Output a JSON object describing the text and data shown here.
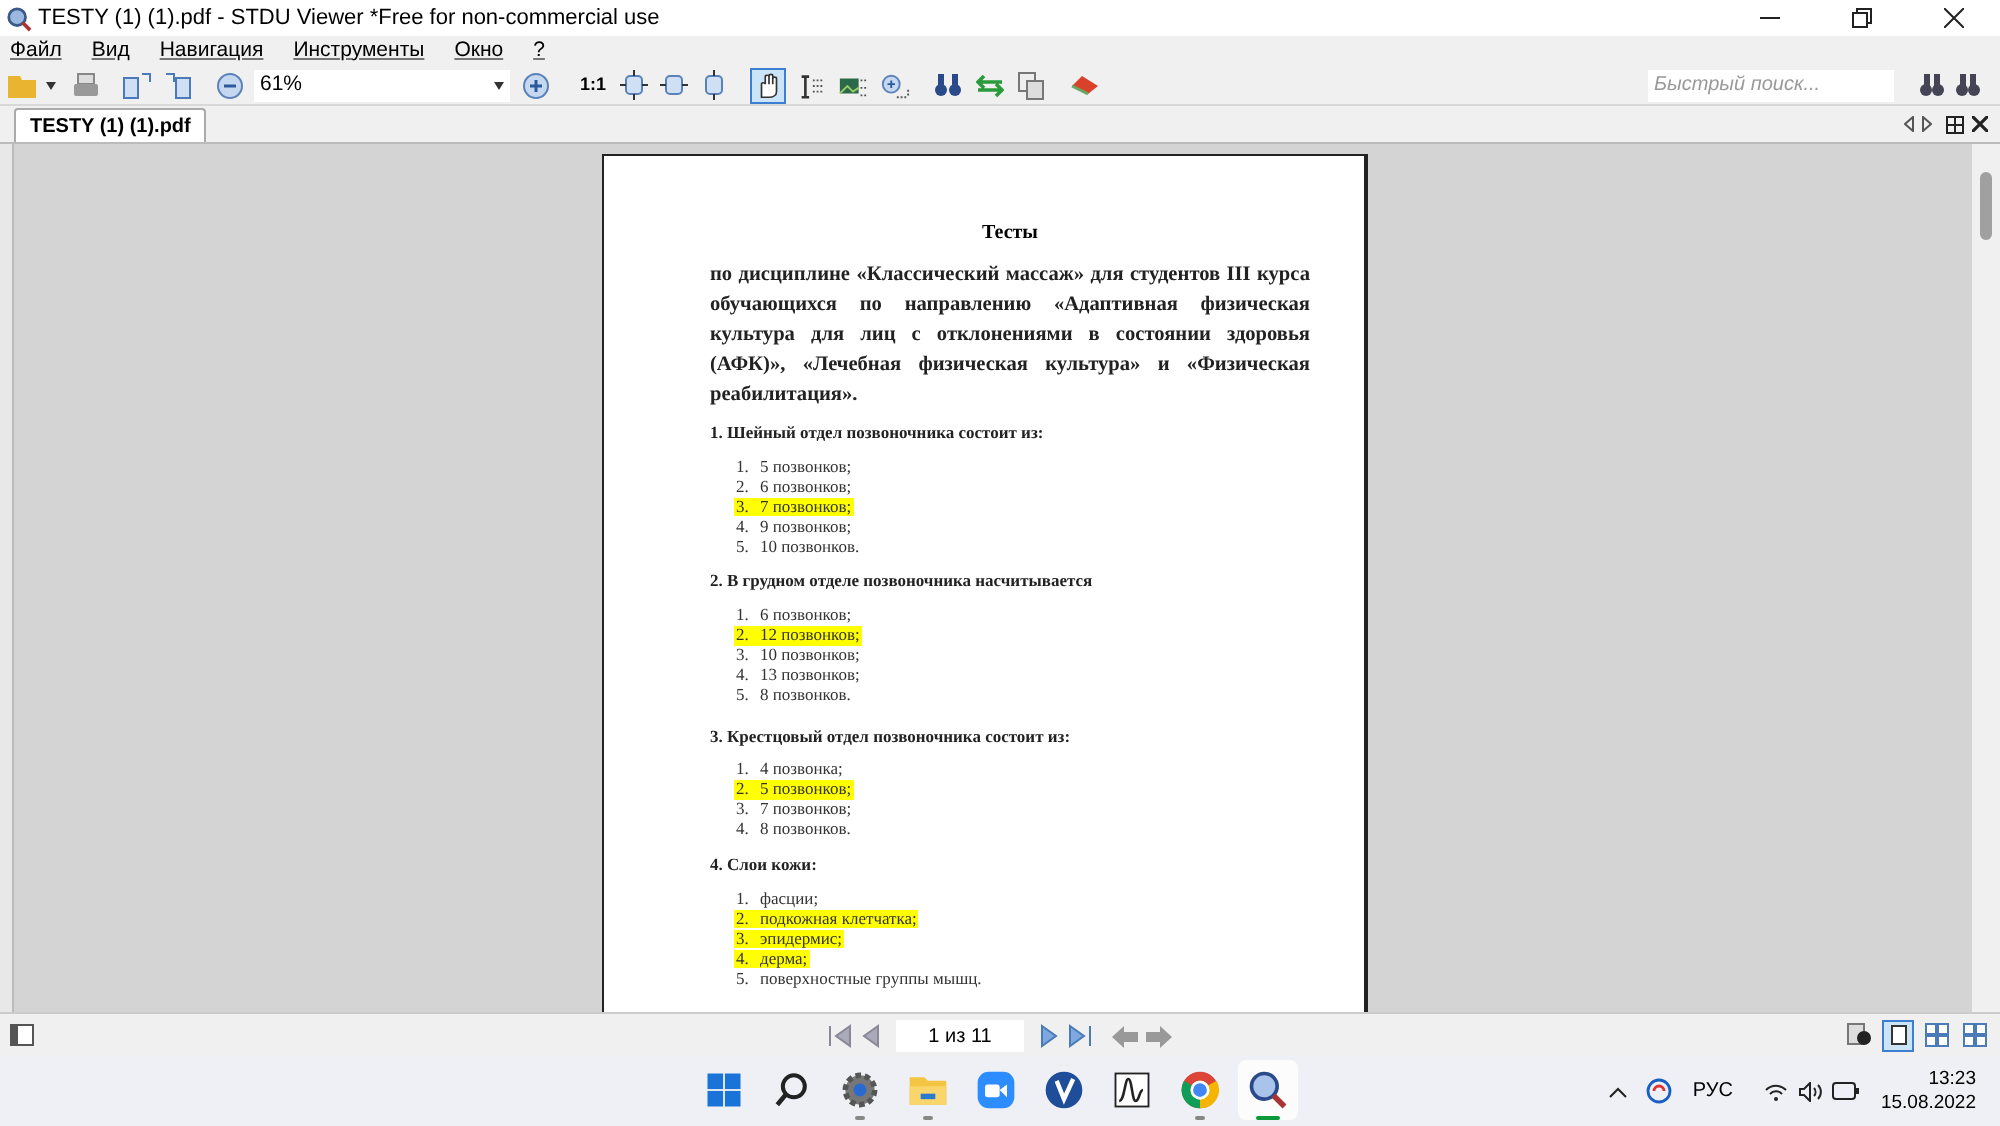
{
  "window": {
    "title": "TESTY (1) (1).pdf - STDU Viewer *Free for non-commercial use"
  },
  "menu": [
    "Файл",
    "Вид",
    "Навигация",
    "Инструменты",
    "Окно",
    "?"
  ],
  "toolbar": {
    "zoom": "61%",
    "one_to_one": "1:1",
    "search_placeholder": "Быстрый поиск...",
    "tools": [
      {
        "kind": "hand",
        "selected": true
      },
      {
        "kind": "text-select",
        "selected": false
      },
      {
        "kind": "image-select",
        "selected": false
      },
      {
        "kind": "zoom-select",
        "selected": false
      }
    ]
  },
  "tabs": [
    {
      "label": "TESTY (1) (1).pdf",
      "selected": true
    }
  ],
  "document": {
    "title": "Тесты",
    "intro": "по дисциплине «Классический массаж» для студентов III курса обучающихся по направлению «Адаптивная физическая культура для лиц с отклонениями в состоянии здоровья (АФК)», «Лечебная физическая культура» и «Физическая реабилитация».",
    "questions": [
      {
        "text": "1. Шейный отдел позвоночника состоит из:",
        "items": [
          {
            "number": "1.",
            "text": "5 позвонков;",
            "highlighted": false
          },
          {
            "number": "2.",
            "text": "6 позвонков;",
            "highlighted": false
          },
          {
            "number": "3.",
            "text": "7 позвонков;",
            "highlighted": true
          },
          {
            "number": "4.",
            "text": "9 позвонков;",
            "highlighted": false
          },
          {
            "number": "5.",
            "text": "10 позвонков.",
            "highlighted": false
          }
        ]
      },
      {
        "text": "2. В грудном отделе позвоночника насчитывается",
        "items": [
          {
            "number": "1.",
            "text": "6 позвонков;",
            "highlighted": false
          },
          {
            "number": "2.",
            "text": "12 позвонков;",
            "highlighted": true
          },
          {
            "number": "3.",
            "text": "10 позвонков;",
            "highlighted": false
          },
          {
            "number": "4.",
            "text": "13 позвонков;",
            "highlighted": false
          },
          {
            "number": "5.",
            "text": "8 позвонков.",
            "highlighted": false
          }
        ]
      },
      {
        "text": "3. Крестцовый отдел позвоночника состоит из:",
        "items": [
          {
            "number": "1.",
            "text": "4 позвонка;",
            "highlighted": false
          },
          {
            "number": "2.",
            "text": "5 позвонков;",
            "highlighted": true
          },
          {
            "number": "3.",
            "text": "7 позвонков;",
            "highlighted": false
          },
          {
            "number": "4.",
            "text": "8 позвонков.",
            "highlighted": false
          }
        ]
      },
      {
        "text": "4. Слои кожи:",
        "items": [
          {
            "number": "1.",
            "text": "фасции;",
            "highlighted": false
          },
          {
            "number": "2.",
            "text": "подкожная клетчатка;",
            "highlighted": true
          },
          {
            "number": "3.",
            "text": "эпидермис;",
            "highlighted": true
          },
          {
            "number": "4.",
            "text": "дерма;",
            "highlighted": true
          },
          {
            "number": "5.",
            "text": "поверхностные группы мышц.",
            "highlighted": false
          }
        ]
      }
    ]
  },
  "status_bar": {
    "page": "1 из 11",
    "views": [
      {
        "kind": "single",
        "selected": true
      },
      {
        "kind": "grid",
        "selected": false
      },
      {
        "kind": "grid",
        "selected": false
      }
    ]
  },
  "taskbar": {
    "apps": [
      {
        "kind": "start",
        "running": false
      },
      {
        "kind": "search",
        "running": false
      },
      {
        "kind": "settings",
        "running": true
      },
      {
        "kind": "folder",
        "running": true
      },
      {
        "kind": "video",
        "running": false
      },
      {
        "kind": "v",
        "running": false
      },
      {
        "kind": "chart",
        "running": false
      },
      {
        "kind": "browser",
        "running": true
      },
      {
        "kind": "viewer",
        "running": true,
        "active": true
      }
    ],
    "language": "РУС",
    "time": "13:23",
    "date": "15.08.2022"
  }
}
